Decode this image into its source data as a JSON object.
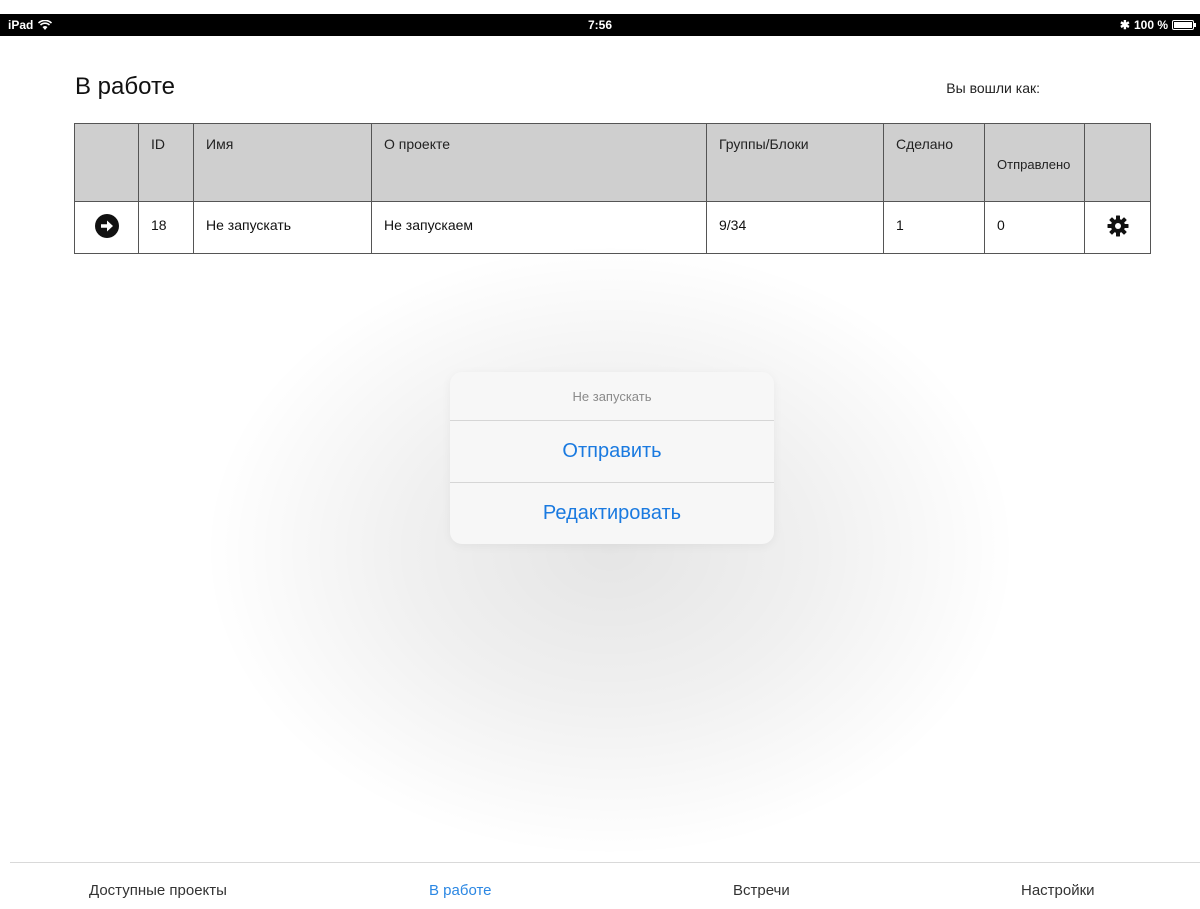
{
  "status": {
    "device": "iPad",
    "time": "7:56",
    "battery": "100 %",
    "battery_level": 1.0
  },
  "header": {
    "title": "В работе",
    "login_label": "Вы вошли как:"
  },
  "table": {
    "columns": [
      "",
      "ID",
      "Имя",
      "О проекте",
      "Группы/Блоки",
      "Сделано",
      "Отправлено",
      ""
    ],
    "rows": [
      {
        "id": "18",
        "name": "Не запускать",
        "about": "Не запускаем",
        "groups": "9/34",
        "done": "1",
        "sent": "0"
      }
    ]
  },
  "action_sheet": {
    "title": "Не запускать",
    "buttons": [
      "Отправить",
      "Редактировать"
    ]
  },
  "tabs": [
    {
      "label": "Доступные проекты",
      "active": false
    },
    {
      "label": "В работе",
      "active": true
    },
    {
      "label": "Встречи",
      "active": false
    },
    {
      "label": "Настройки",
      "active": false
    }
  ],
  "colors": {
    "accent": "#1a7ae0",
    "header_bg": "#cfcfcf",
    "tab_active": "#2b87e3"
  }
}
